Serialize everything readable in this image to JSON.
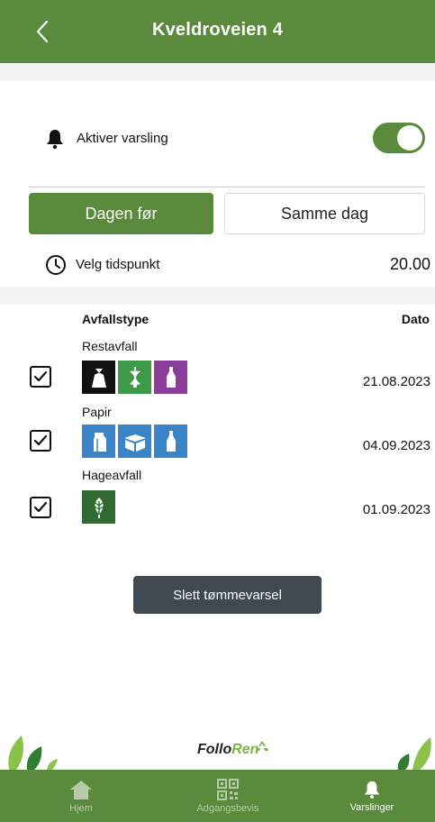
{
  "header": {
    "title": "Kveldroveien 4"
  },
  "notification": {
    "label": "Aktiver varsling",
    "enabled": true
  },
  "timing": {
    "options": [
      "Dagen før",
      "Samme dag"
    ],
    "selected": "Dagen før"
  },
  "time": {
    "label": "Velg tidspunkt",
    "value": "20.00"
  },
  "table": {
    "col_type": "Avfallstype",
    "col_date": "Dato"
  },
  "waste_types": [
    {
      "name": "Restavfall",
      "date": "21.08.2023",
      "checked": true,
      "icons": [
        "trash-bag-icon",
        "apple-core-icon",
        "bottle-icon"
      ],
      "colors": [
        "#111111",
        "#3e9a49",
        "#8b3d9a"
      ]
    },
    {
      "name": "Papir",
      "date": "04.09.2023",
      "checked": true,
      "icons": [
        "milk-carton-icon",
        "cardboard-box-icon",
        "bottle-icon"
      ],
      "colors": [
        "#3a84c8",
        "#3a84c8",
        "#3a84c8"
      ]
    },
    {
      "name": "Hageavfall",
      "date": "01.09.2023",
      "checked": true,
      "icons": [
        "leaf-icon"
      ],
      "colors": [
        "#2f6b30"
      ]
    }
  ],
  "delete_button": "Slett tømmevarsel",
  "brand": {
    "part1": "Follo",
    "part2": "Ren"
  },
  "tabs": [
    {
      "label": "Hjem",
      "icon": "home-icon",
      "active": false
    },
    {
      "label": "Adgangsbevis",
      "icon": "qr-code-icon",
      "active": false
    },
    {
      "label": "Varslinger",
      "icon": "bell-icon",
      "active": true
    }
  ],
  "colors": {
    "primary": "#5a8a3c",
    "dark_button": "#404950",
    "tab_inactive": "#b7cba6"
  }
}
